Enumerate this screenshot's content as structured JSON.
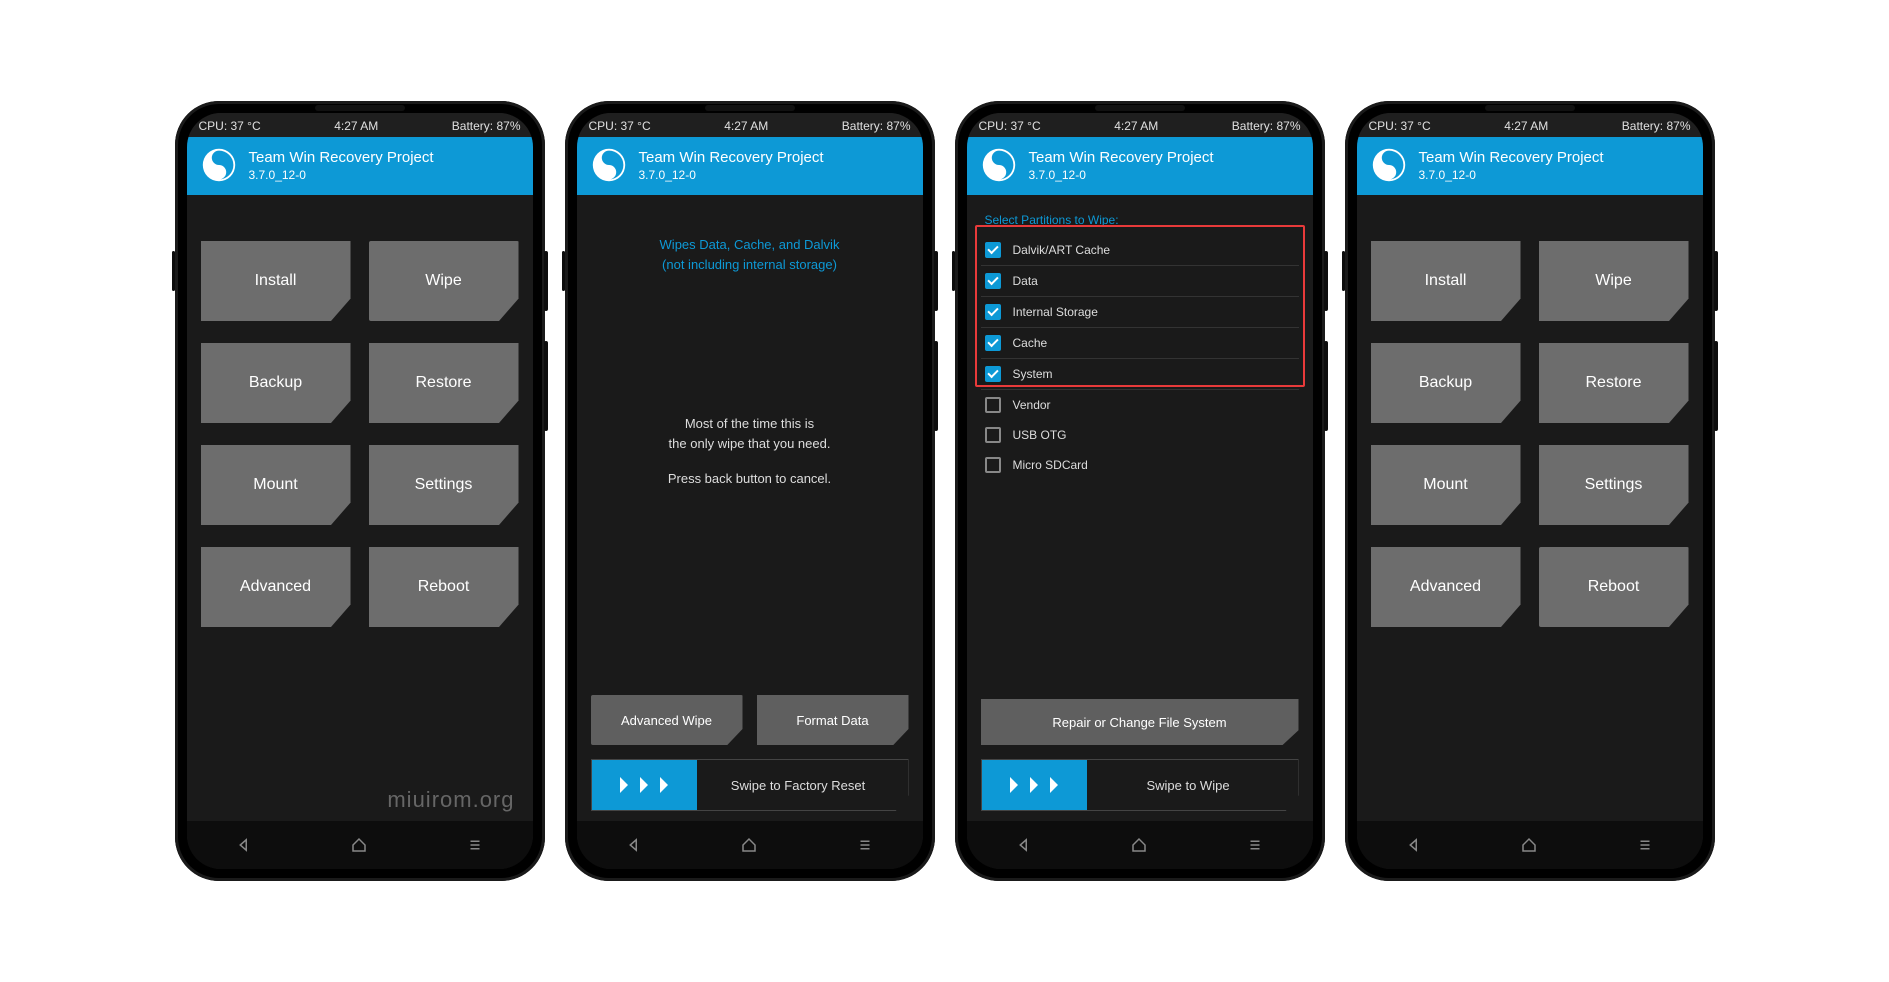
{
  "status": {
    "cpu": "CPU: 37 °C",
    "time": "4:27 AM",
    "battery": "Battery: 87%"
  },
  "header": {
    "title": "Team Win Recovery Project",
    "version": "3.7.0_12-0"
  },
  "tiles": {
    "install": "Install",
    "wipe": "Wipe",
    "backup": "Backup",
    "restore": "Restore",
    "mount": "Mount",
    "settings": "Settings",
    "advanced": "Advanced",
    "reboot": "Reboot"
  },
  "wipe_screen": {
    "desc1": "Wipes Data, Cache, and Dalvik",
    "desc2": "(not including internal storage)",
    "hint1": "Most of the time this is",
    "hint2": "the only wipe that you need.",
    "hint3": "Press back button to cancel.",
    "adv_wipe": "Advanced Wipe",
    "format_data": "Format Data",
    "swipe": "Swipe to Factory Reset"
  },
  "partitions_screen": {
    "label": "Select Partitions to Wipe:",
    "items": [
      {
        "name": "Dalvik/ART Cache",
        "checked": true
      },
      {
        "name": "Data",
        "checked": true
      },
      {
        "name": "Internal Storage",
        "checked": true
      },
      {
        "name": "Cache",
        "checked": true
      },
      {
        "name": "System",
        "checked": true
      },
      {
        "name": "Vendor",
        "checked": false
      },
      {
        "name": "USB OTG",
        "checked": false
      },
      {
        "name": "Micro SDCard",
        "checked": false
      }
    ],
    "repair": "Repair or Change File System",
    "swipe": "Swipe to Wipe"
  },
  "watermark": "miuirom.org"
}
